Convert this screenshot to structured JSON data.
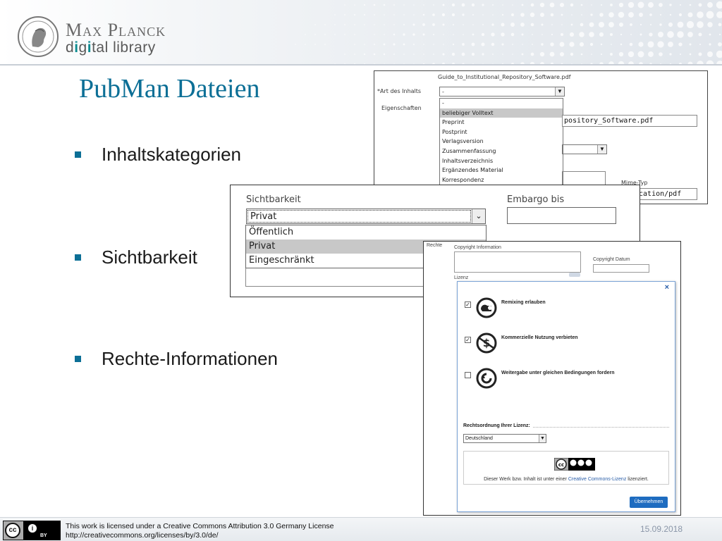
{
  "logo": {
    "line1": "Max Planck",
    "line2_a": "d",
    "line2_b": "i",
    "line2_c": "g",
    "line2_d": "i",
    "line2_e": "tal library"
  },
  "slide": {
    "title": "PubMan Dateien",
    "bullets": [
      "Inhaltskategorien",
      "Sichtbarkeit",
      "Rechte-Informationen"
    ]
  },
  "panel1": {
    "filename": "Guide_to_Institutional_Repository_Software.pdf",
    "label_art": "*Art des Inhalts",
    "label_eigenschaften": "Eigenschaften",
    "select_value": "-",
    "options": [
      "-",
      "beliebiger Volltext",
      "Preprint",
      "Postprint",
      "Verlagsversion",
      "Zusammenfassung",
      "Inhaltsverzeichnis",
      "Ergänzendes Material",
      "Korrespondenz"
    ],
    "highlighted_index": 1,
    "filename_field": "pository_Software.pdf",
    "mime_label": "Mime-Typ",
    "mime_field": "ication/pdf"
  },
  "panel2": {
    "label_sichtbarkeit": "Sichtbarkeit",
    "label_embargo": "Embargo bis",
    "select_value": "Privat",
    "options": [
      "Öffentlich",
      "Privat",
      "Eingeschränkt"
    ],
    "highlighted_index": 1
  },
  "panel3": {
    "label_rechte": "Rechte",
    "label_copyright": "Copyright Information",
    "label_copyright_datum": "Copyright Datum",
    "label_lizenz": "Lizenz",
    "close_symbol": "×",
    "options": [
      {
        "checked": true,
        "label": "Remixing erlauben"
      },
      {
        "checked": true,
        "label": "Kommerzielle Nutzung verbieten"
      },
      {
        "checked": false,
        "label": "Weitergabe unter gleichen Bedingungen fordern"
      }
    ],
    "rechtsordnung_label": "Rechtsordnung Ihrer Lizenz:",
    "rechtsordnung_value": "Deutschland",
    "info_text_pre": "Dieser Werk bzw. Inhalt ist unter einer",
    "info_text_link": "Creative Commons-Lizenz",
    "info_text_post": "lizenziert.",
    "ok_button": "Übernehmen"
  },
  "footer": {
    "license_line1": "This work is licensed under a Creative Commons Attribution 3.0 Germany License",
    "license_line2": "http://creativecommons.org/licenses/by/3.0/de/",
    "date": "15.09.2018",
    "cc_by_text": "BY",
    "cc_symbol": "cc",
    "by_symbol": "i"
  },
  "colors": {
    "title": "#0c6f96",
    "bullet": "#0c6f96",
    "teal_logo": "#0d8c91",
    "date": "#8a96a8"
  }
}
